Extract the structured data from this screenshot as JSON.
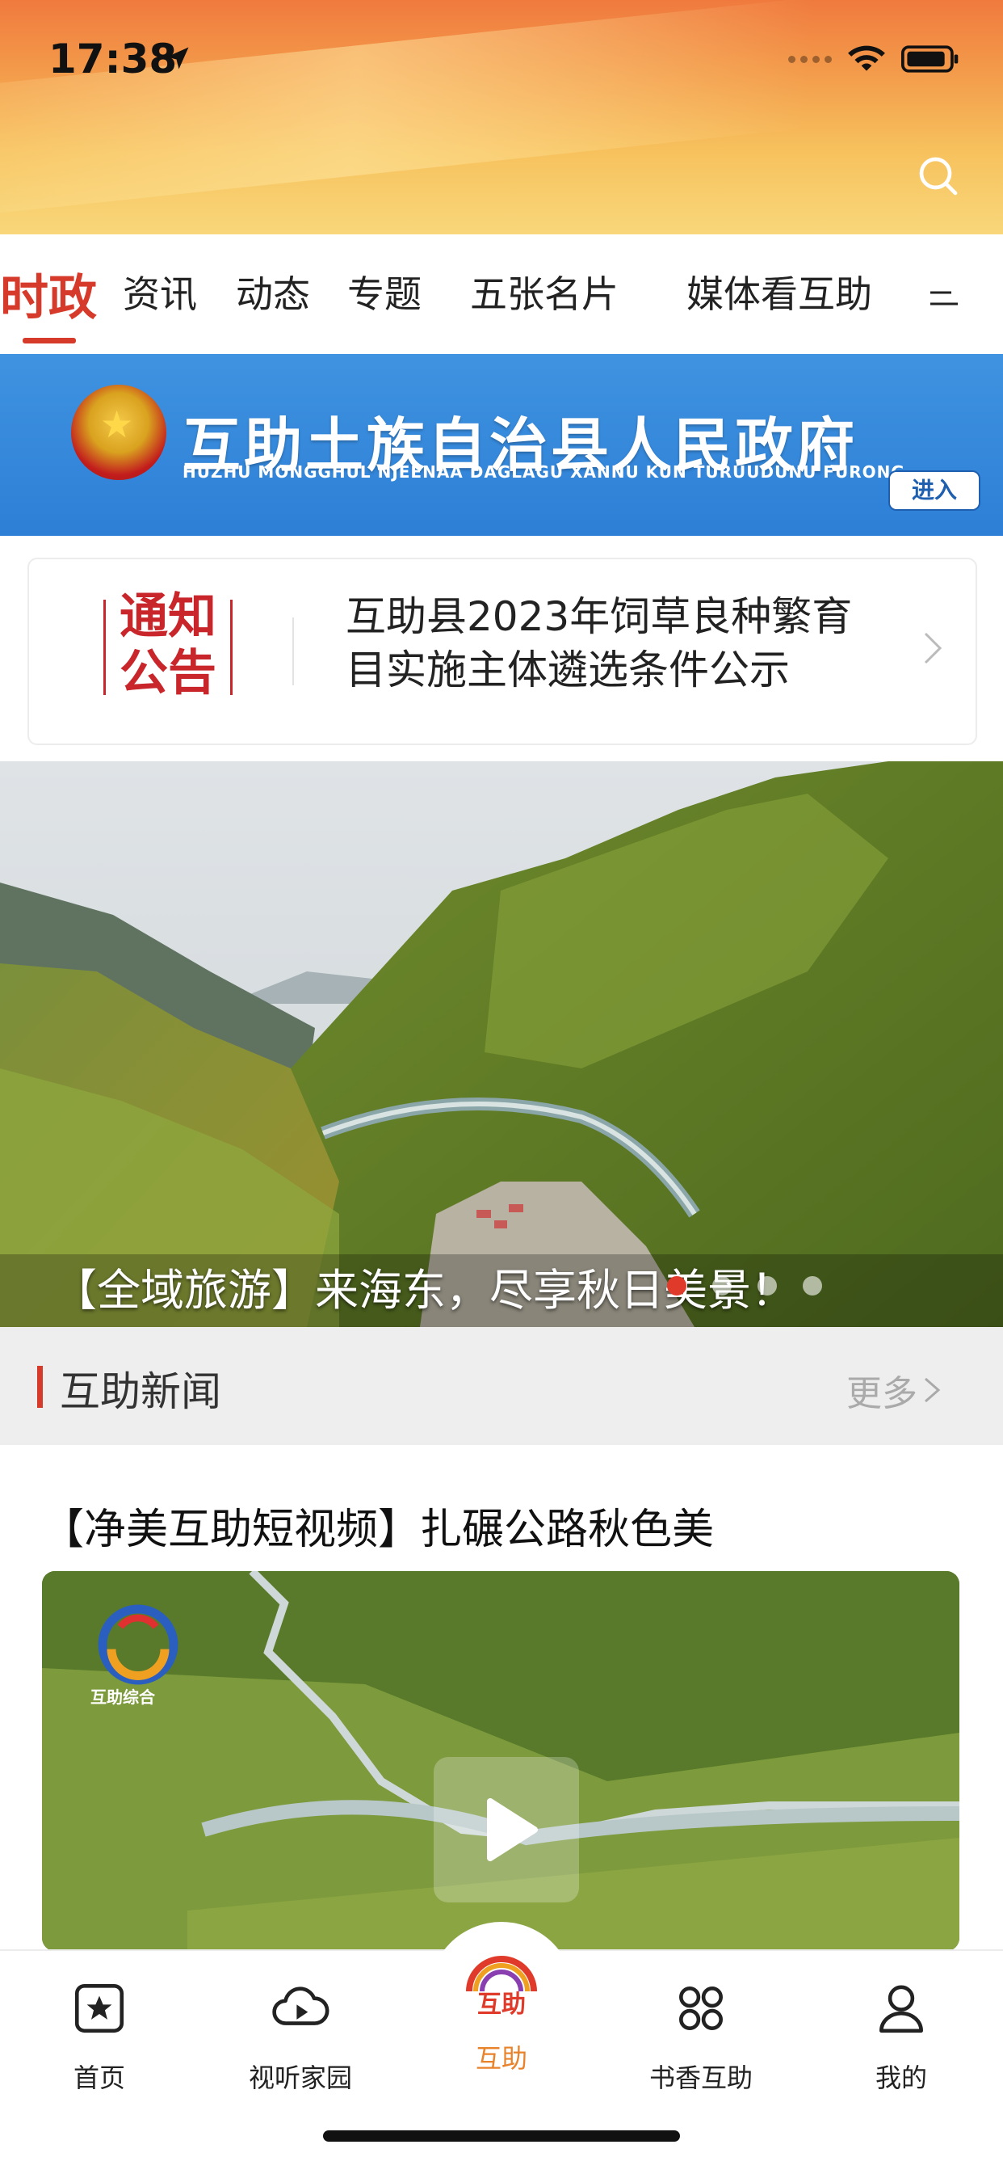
{
  "status_bar": {
    "time": "17:38"
  },
  "tabs": [
    {
      "label": "时政",
      "active": true
    },
    {
      "label": "资讯"
    },
    {
      "label": "动态"
    },
    {
      "label": "专题"
    },
    {
      "label": "五张名片"
    },
    {
      "label": "媒体看互助"
    }
  ],
  "gov_banner": {
    "title": "互助土族自治县人民政府",
    "subtitle": "HUZHU MONGGHUL NJEENAA DAGLAGU XANNU KUN TURUUDUNU FURONG",
    "enter_label": "进入"
  },
  "notice": {
    "badge_line1": "通知",
    "badge_line2": "公告",
    "text_line1": "互助县2023年饲草良种繁育",
    "text_line2": "目实施主体遴选条件公示"
  },
  "hero": {
    "caption": "【全域旅游】来海东，尽享秋日美景！",
    "dot_count": 5,
    "active_dot": 0
  },
  "news_section": {
    "title": "互助新闻",
    "more_label": "更多"
  },
  "news_item": {
    "title": "【净美互助短视频】扎碾公路秋色美",
    "logo_text": "互助综合"
  },
  "bottom_nav": {
    "items": [
      {
        "label": "首页",
        "icon": "star-square-icon"
      },
      {
        "label": "视听家园",
        "icon": "cloud-play-icon"
      },
      {
        "label": "互助",
        "icon": "huzhu-logo-icon",
        "active": true
      },
      {
        "label": "书香互助",
        "icon": "grid-clover-icon"
      },
      {
        "label": "我的",
        "icon": "person-icon"
      }
    ],
    "center_logo_text": "互助"
  },
  "colors": {
    "accent": "#d63a2a",
    "nav_active": "#e8832b",
    "banner_blue": "#2d7fd6"
  }
}
